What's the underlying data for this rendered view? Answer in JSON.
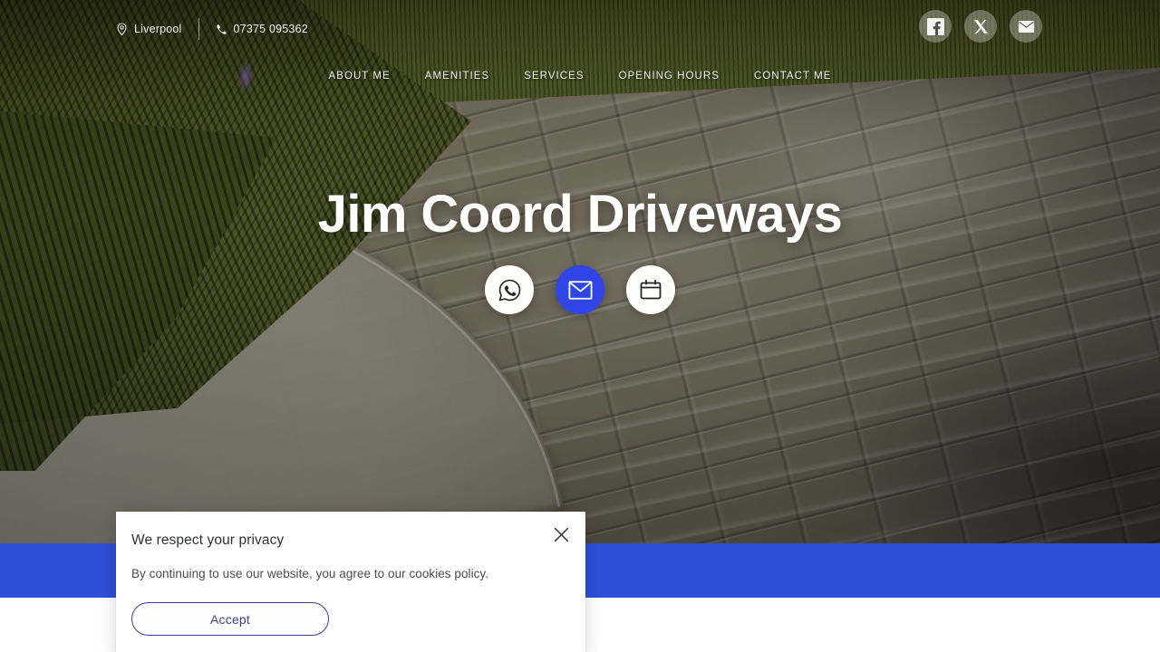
{
  "site": {
    "title": "Jim Coord Driveways"
  },
  "topbar": {
    "location": {
      "label": "Liverpool",
      "icon": "map-pin-icon"
    },
    "phone": {
      "label": "07375 095362",
      "icon": "phone-icon"
    },
    "socials": [
      {
        "name": "facebook",
        "icon": "facebook-icon",
        "label": "Facebook"
      },
      {
        "name": "x-twitter",
        "icon": "x-twitter-icon",
        "label": "X"
      },
      {
        "name": "email",
        "icon": "email-icon",
        "label": "Email"
      }
    ]
  },
  "nav": {
    "items": [
      {
        "label": "ABOUT ME"
      },
      {
        "label": "AMENITIES"
      },
      {
        "label": "SERVICES"
      },
      {
        "label": "OPENING HOURS"
      },
      {
        "label": "CONTACT ME"
      }
    ]
  },
  "hero": {
    "heading": "Jim Coord Driveways",
    "cta_buttons": [
      {
        "name": "whatsapp",
        "icon": "whatsapp-icon",
        "style": "white"
      },
      {
        "name": "email",
        "icon": "envelope-icon",
        "style": "blue"
      },
      {
        "name": "booking",
        "icon": "calendar-icon",
        "style": "white"
      }
    ]
  },
  "cookie_dialog": {
    "title": "We respect your privacy",
    "body": "By continuing to use our website, you agree to our cookies policy.",
    "accept_label": "Accept",
    "close_icon": "close-icon"
  },
  "colors": {
    "brand_blue": "#2e4fd8",
    "cta_blue": "#2f45e6",
    "accept_outline": "#3f3d8f",
    "hero_text": "#ffffff"
  }
}
